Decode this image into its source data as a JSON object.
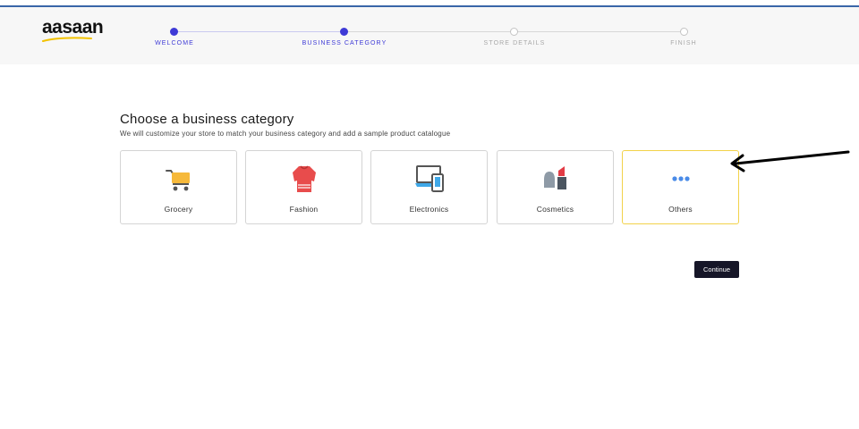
{
  "brand": {
    "logo_text": "aasaan",
    "logo_underline_color": "#f2c200"
  },
  "stepper": {
    "steps": [
      {
        "label": "WELCOME",
        "state": "done"
      },
      {
        "label": "BUSINESS CATEGORY",
        "state": "done"
      },
      {
        "label": "STORE DETAILS",
        "state": "todo"
      },
      {
        "label": "FINISH",
        "state": "todo"
      }
    ],
    "active_color": "#3e3ad6"
  },
  "main": {
    "title": "Choose a business category",
    "subtitle": "We will customize your store to match your business category and add a sample product catalogue",
    "categories": [
      {
        "label": "Grocery",
        "icon": "shopping-cart-icon",
        "selected": false
      },
      {
        "label": "Fashion",
        "icon": "shirt-icon",
        "selected": false
      },
      {
        "label": "Electronics",
        "icon": "devices-icon",
        "selected": false
      },
      {
        "label": "Cosmetics",
        "icon": "lipstick-icon",
        "selected": false
      },
      {
        "label": "Others",
        "icon": "more-dots-icon",
        "selected": true
      }
    ],
    "selected_border_color": "#f2d24a",
    "continue_label": "Continue"
  },
  "annotation": {
    "icon": "pointer-arrow-icon"
  }
}
